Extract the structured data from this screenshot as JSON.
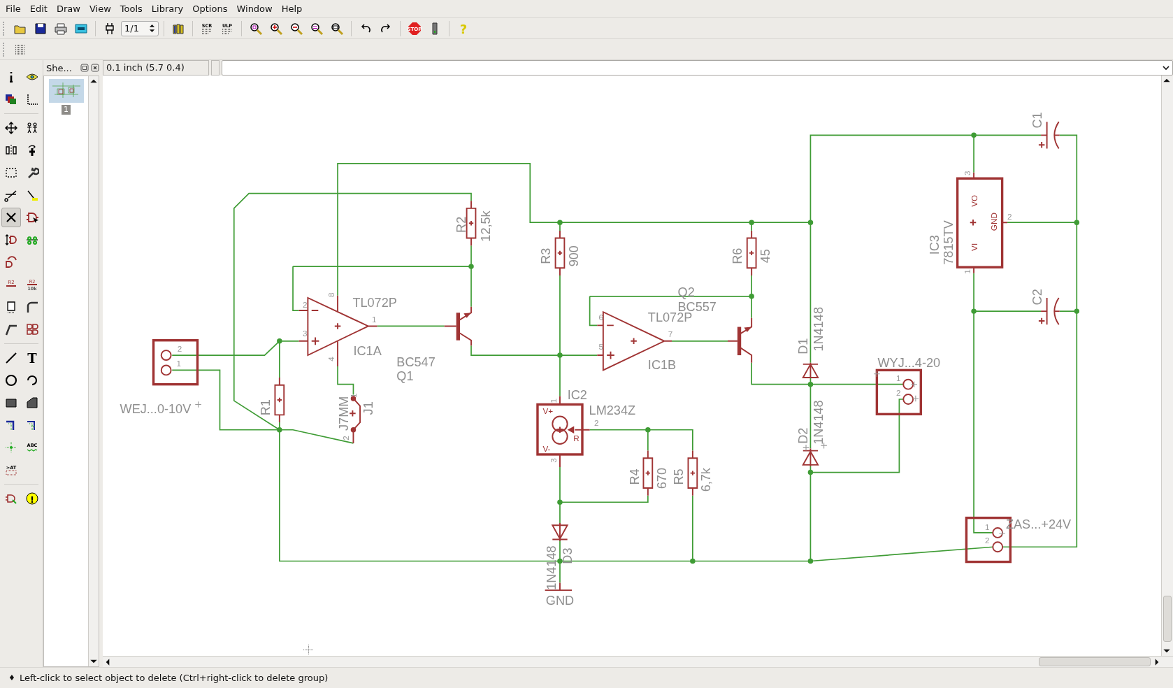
{
  "menu": [
    {
      "label": "File"
    },
    {
      "label": "Edit"
    },
    {
      "label": "Draw"
    },
    {
      "label": "View"
    },
    {
      "label": "Tools"
    },
    {
      "label": "Library"
    },
    {
      "label": "Options"
    },
    {
      "label": "Window"
    },
    {
      "label": "Help"
    }
  ],
  "toolbar": {
    "groups": [
      [
        {
          "kind": "open"
        },
        {
          "kind": "save"
        },
        {
          "kind": "print"
        },
        {
          "kind": "cam"
        }
      ],
      [
        {
          "kind": "board"
        },
        {
          "kind": "sheet",
          "value": "1/1"
        }
      ],
      [
        {
          "kind": "library"
        }
      ],
      [
        {
          "kind": "script",
          "label": "SCR"
        },
        {
          "kind": "ulp",
          "label": "ULP"
        }
      ],
      [
        {
          "kind": "zoomfit"
        },
        {
          "kind": "zoomin"
        },
        {
          "kind": "zoomout"
        },
        {
          "kind": "redraw"
        },
        {
          "kind": "zoomselect"
        }
      ],
      [
        {
          "kind": "undo"
        },
        {
          "kind": "redo"
        }
      ],
      [
        {
          "kind": "stop",
          "label": "STOP"
        },
        {
          "kind": "go"
        }
      ],
      [
        {
          "kind": "help",
          "label": "?"
        }
      ]
    ]
  },
  "toolbar2": [
    {
      "kind": "grid"
    }
  ],
  "tools": {
    "groups": [
      [
        [
          {
            "kind": "info",
            "selected": false
          },
          {
            "kind": "eye",
            "selected": false
          }
        ],
        [
          {
            "kind": "layers",
            "selected": false
          },
          {
            "kind": "mark",
            "selected": false
          }
        ]
      ],
      [
        [
          {
            "kind": "move",
            "selected": false
          },
          {
            "kind": "copy",
            "selected": false
          }
        ],
        [
          {
            "kind": "mirror",
            "selected": false
          },
          {
            "kind": "rotate",
            "selected": false
          }
        ],
        [
          {
            "kind": "group",
            "selected": false
          },
          {
            "kind": "change",
            "selected": false
          }
        ],
        [
          {
            "kind": "cut",
            "selected": false
          },
          {
            "kind": "paste",
            "selected": false
          }
        ],
        [
          {
            "kind": "delete",
            "selected": true
          },
          {
            "kind": "add",
            "selected": false
          }
        ],
        [
          {
            "kind": "pinswap",
            "selected": false
          },
          {
            "kind": "gateswap",
            "selected": false
          }
        ],
        [
          {
            "kind": "replace",
            "selected": false
          }
        ],
        [
          {
            "kind": "name",
            "label": "R2",
            "selected": false
          },
          {
            "kind": "value",
            "label": "R2",
            "sublabel": "10k",
            "selected": false
          }
        ],
        [
          {
            "kind": "smash",
            "selected": false
          },
          {
            "kind": "miter",
            "selected": false
          }
        ],
        [
          {
            "kind": "split",
            "selected": false
          },
          {
            "kind": "invoke",
            "selected": false
          }
        ]
      ],
      [
        [
          {
            "kind": "line",
            "selected": false
          },
          {
            "kind": "text",
            "label": "T",
            "selected": false
          }
        ],
        [
          {
            "kind": "circle",
            "selected": false
          },
          {
            "kind": "arc",
            "selected": false
          }
        ],
        [
          {
            "kind": "rect",
            "selected": false
          },
          {
            "kind": "polygon",
            "selected": false
          }
        ],
        [
          {
            "kind": "bus",
            "selected": false
          },
          {
            "kind": "net",
            "selected": false
          }
        ],
        [
          {
            "kind": "junction",
            "selected": false
          },
          {
            "kind": "labeltool",
            "label": "ABC",
            "selected": false
          }
        ],
        [
          {
            "kind": "attribute",
            "label": ">AT",
            "selected": false
          }
        ]
      ],
      [
        [
          {
            "kind": "erc",
            "selected": false
          },
          {
            "kind": "errors",
            "label": "!",
            "selected": false
          }
        ]
      ]
    ]
  },
  "sheets": {
    "title": "She...",
    "pages": [
      {
        "label": "1",
        "selected": true
      }
    ]
  },
  "grid_readout": "0.1 inch (5.7 0.4)",
  "schematic": {
    "labels": [
      {
        "text": "TL072P",
        "kind": "name"
      },
      {
        "text": "IC1A",
        "kind": "name"
      },
      {
        "text": "BC547",
        "kind": "name"
      },
      {
        "text": "Q1",
        "kind": "name"
      },
      {
        "text": "R2",
        "kind": "name"
      },
      {
        "text": "12,5k",
        "kind": "name"
      },
      {
        "text": "R3",
        "kind": "name"
      },
      {
        "text": "900",
        "kind": "name"
      },
      {
        "text": "TL072P",
        "kind": "name"
      },
      {
        "text": "IC1B",
        "kind": "name"
      },
      {
        "text": "Q2",
        "kind": "name"
      },
      {
        "text": "BC557",
        "kind": "name"
      },
      {
        "text": "R6",
        "kind": "name"
      },
      {
        "text": "45",
        "kind": "name"
      },
      {
        "text": "WEJ...0-10V",
        "kind": "name"
      },
      {
        "text": "R1",
        "kind": "name"
      },
      {
        "text": "J7MM",
        "kind": "name"
      },
      {
        "text": "J1",
        "kind": "name"
      },
      {
        "text": "IC2",
        "kind": "name"
      },
      {
        "text": "LM234Z",
        "kind": "name"
      },
      {
        "text": "R4",
        "kind": "name"
      },
      {
        "text": "670",
        "kind": "name"
      },
      {
        "text": "R5",
        "kind": "name"
      },
      {
        "text": "6,7k",
        "kind": "name"
      },
      {
        "text": "D3",
        "kind": "name"
      },
      {
        "text": "1N4148",
        "kind": "name"
      },
      {
        "text": "GND",
        "kind": "name"
      },
      {
        "text": "D1",
        "kind": "name"
      },
      {
        "text": "1N4148",
        "kind": "name"
      },
      {
        "text": "D2",
        "kind": "name"
      },
      {
        "text": "1N4148",
        "kind": "name"
      },
      {
        "text": "WYJ...4-20",
        "kind": "name"
      },
      {
        "text": "IC3",
        "kind": "name"
      },
      {
        "text": "7815TV",
        "kind": "name"
      },
      {
        "text": "C1",
        "kind": "name"
      },
      {
        "text": "C2",
        "kind": "name"
      },
      {
        "text": "ZAS...+24V",
        "kind": "name"
      },
      {
        "text": "2",
        "kind": "pin"
      },
      {
        "text": "1",
        "kind": "pin"
      },
      {
        "text": "2",
        "kind": "pin"
      },
      {
        "text": "3",
        "kind": "pin"
      },
      {
        "text": "8",
        "kind": "pin"
      },
      {
        "text": "4",
        "kind": "pin"
      },
      {
        "text": "1",
        "kind": "pin"
      },
      {
        "text": "1",
        "kind": "pin"
      },
      {
        "text": "2",
        "kind": "pin"
      },
      {
        "text": "6",
        "kind": "pin"
      },
      {
        "text": "5",
        "kind": "pin"
      },
      {
        "text": "7",
        "kind": "pin"
      },
      {
        "text": "1",
        "kind": "pin"
      },
      {
        "text": "2",
        "kind": "pin"
      },
      {
        "text": "3",
        "kind": "pin"
      },
      {
        "text": "1",
        "kind": "pin"
      },
      {
        "text": "2",
        "kind": "pin"
      },
      {
        "text": "3",
        "kind": "pin"
      },
      {
        "text": "2",
        "kind": "pin"
      },
      {
        "text": "1",
        "kind": "pin"
      },
      {
        "text": "1",
        "kind": "pin"
      },
      {
        "text": "2",
        "kind": "pin"
      },
      {
        "text": "V+",
        "kind": "symbol"
      },
      {
        "text": "V-",
        "kind": "symbol"
      },
      {
        "text": "R",
        "kind": "symbol"
      },
      {
        "text": "VO",
        "kind": "symbol"
      },
      {
        "text": "GND",
        "kind": "symbol"
      },
      {
        "text": "VI",
        "kind": "symbol"
      }
    ]
  },
  "status_bar": {
    "icon": "♦",
    "text": "Left-click to select object to delete (Ctrl+right-click to delete group)"
  }
}
